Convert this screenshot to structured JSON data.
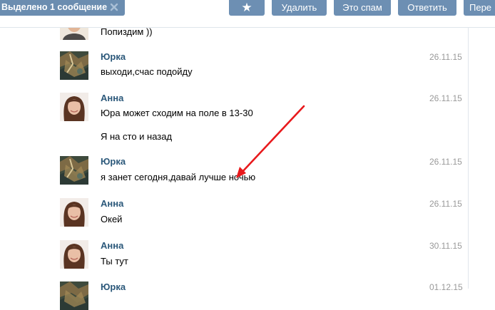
{
  "toolbar": {
    "selected_label": "Выделено 1 сообщение",
    "star_label": "★",
    "delete_label": "Удалить",
    "spam_label": "Это спам",
    "reply_label": "Ответить",
    "forward_label": "Пере"
  },
  "messages": [
    {
      "author": "",
      "date": "",
      "text": "Попиздим ))"
    },
    {
      "author": "Юрка",
      "date": "26.11.15",
      "text": "выходи,счас подойду"
    },
    {
      "author": "Анна",
      "date": "26.11.15",
      "text": "Юра может сходим на поле в 13-30",
      "text2": "Я на сто и назад"
    },
    {
      "author": "Юрка",
      "date": "26.11.15",
      "text": "я занет сегодня,давай лучше ночью"
    },
    {
      "author": "Анна",
      "date": "26.11.15",
      "text": "Окей"
    },
    {
      "author": "Анна",
      "date": "30.11.15",
      "text": "Ты тут"
    },
    {
      "author": "Юрка",
      "date": "01.12.15",
      "text": ""
    }
  ],
  "colors": {
    "toolbar_button": "#6d8fb3",
    "author_link": "#2b587a",
    "date": "#999999",
    "annotation_arrow": "#e8191c"
  }
}
